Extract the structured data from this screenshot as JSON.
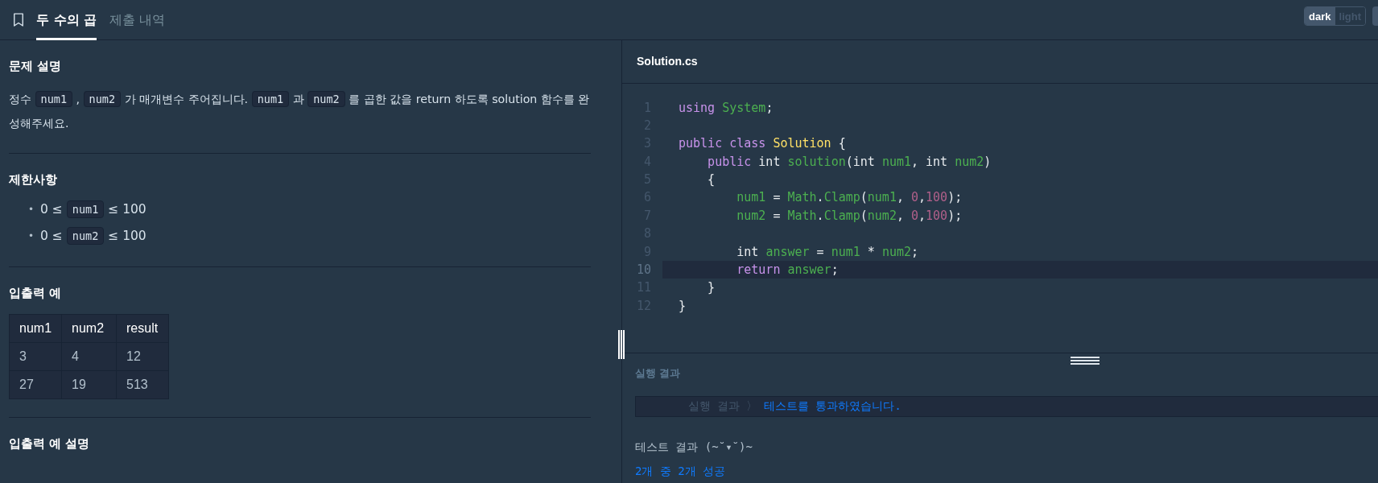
{
  "tabs": [
    {
      "label": "두 수의 곱",
      "selected": true
    },
    {
      "label": "제출 내역",
      "selected": false
    }
  ],
  "theme_toggle": [
    {
      "label": "dark",
      "selected": true
    },
    {
      "label": "light",
      "selected": false
    }
  ],
  "description": {
    "title": "문제 설명",
    "paragraph": [
      {
        "kind": "text",
        "text": "정수 "
      },
      {
        "kind": "code",
        "text": "num1"
      },
      {
        "kind": "text",
        "text": " , "
      },
      {
        "kind": "code",
        "text": "num2"
      },
      {
        "kind": "text",
        "text": " 가 매개변수 주어집니다. "
      },
      {
        "kind": "code",
        "text": "num1"
      },
      {
        "kind": "text",
        "text": " 과 "
      },
      {
        "kind": "code",
        "text": "num2"
      },
      {
        "kind": "text",
        "text": " 를 곱한 값을 return 하도록 solution 함수를 완성해주세요."
      }
    ]
  },
  "constraints": {
    "title": "제한사항",
    "items": [
      {
        "marker": "•",
        "segments": [
          {
            "kind": "text",
            "text": "0 ≤ "
          },
          {
            "kind": "code",
            "text": "num1"
          },
          {
            "kind": "text",
            "text": " ≤ 100"
          }
        ]
      },
      {
        "marker": "•",
        "segments": [
          {
            "kind": "text",
            "text": "0 ≤ "
          },
          {
            "kind": "code",
            "text": "num2"
          },
          {
            "kind": "text",
            "text": " ≤ 100"
          }
        ]
      }
    ]
  },
  "examples": {
    "title": "입출력 예",
    "columns": [
      "num1",
      "num2",
      "result"
    ],
    "rows": [
      [
        "3",
        "4",
        "12"
      ],
      [
        "27",
        "19",
        "513"
      ]
    ]
  },
  "examples_explanation": {
    "title": "입출력 예 설명"
  },
  "editor": {
    "filename": "Solution.cs",
    "lines": [
      {
        "number": "1",
        "highlighted": false,
        "tokens": [
          {
            "kind": "keyword",
            "text": "using "
          },
          {
            "kind": "ident",
            "text": "System"
          },
          {
            "kind": "plain",
            "text": ";"
          }
        ]
      },
      {
        "number": "2",
        "highlighted": false
      },
      {
        "number": "3",
        "highlighted": false,
        "tokens": [
          {
            "kind": "keyword",
            "text": "public class "
          },
          {
            "kind": "type",
            "text": "Solution"
          },
          {
            "kind": "plain",
            "text": " {"
          }
        ]
      },
      {
        "number": "4",
        "highlighted": false,
        "tokens": [
          {
            "kind": "keyword",
            "text": "    public"
          },
          {
            "kind": "plain",
            "text": " int "
          },
          {
            "kind": "ident",
            "text": "solution"
          },
          {
            "kind": "plain",
            "text": "(int "
          },
          {
            "kind": "ident",
            "text": "num1"
          },
          {
            "kind": "plain",
            "text": ", int "
          },
          {
            "kind": "ident",
            "text": "num2"
          },
          {
            "kind": "plain",
            "text": ")"
          }
        ]
      },
      {
        "number": "5",
        "highlighted": false,
        "tokens": [
          {
            "kind": "plain",
            "text": "    {"
          }
        ]
      },
      {
        "number": "6",
        "highlighted": false,
        "tokens": [
          {
            "kind": "ident",
            "text": "        num1"
          },
          {
            "kind": "plain",
            "text": " = "
          },
          {
            "kind": "ident",
            "text": "Math"
          },
          {
            "kind": "plain",
            "text": "."
          },
          {
            "kind": "ident",
            "text": "Clamp"
          },
          {
            "kind": "plain",
            "text": "("
          },
          {
            "kind": "ident",
            "text": "num1"
          },
          {
            "kind": "plain",
            "text": ", "
          },
          {
            "kind": "number",
            "text": "0"
          },
          {
            "kind": "plain",
            "text": ","
          },
          {
            "kind": "number",
            "text": "100"
          },
          {
            "kind": "plain",
            "text": ");"
          }
        ]
      },
      {
        "number": "7",
        "highlighted": false,
        "tokens": [
          {
            "kind": "ident",
            "text": "        num2"
          },
          {
            "kind": "plain",
            "text": " = "
          },
          {
            "kind": "ident",
            "text": "Math"
          },
          {
            "kind": "plain",
            "text": "."
          },
          {
            "kind": "ident",
            "text": "Clamp"
          },
          {
            "kind": "plain",
            "text": "("
          },
          {
            "kind": "ident",
            "text": "num2"
          },
          {
            "kind": "plain",
            "text": ", "
          },
          {
            "kind": "number",
            "text": "0"
          },
          {
            "kind": "plain",
            "text": ","
          },
          {
            "kind": "number",
            "text": "100"
          },
          {
            "kind": "plain",
            "text": ");"
          }
        ]
      },
      {
        "number": "8",
        "highlighted": false
      },
      {
        "number": "9",
        "highlighted": false,
        "tokens": [
          {
            "kind": "plain",
            "text": "        int "
          },
          {
            "kind": "ident",
            "text": "answer"
          },
          {
            "kind": "plain",
            "text": " = "
          },
          {
            "kind": "ident",
            "text": "num1"
          },
          {
            "kind": "plain",
            "text": " * "
          },
          {
            "kind": "ident",
            "text": "num2"
          },
          {
            "kind": "plain",
            "text": ";"
          }
        ]
      },
      {
        "number": "10",
        "highlighted": true,
        "tokens": [
          {
            "kind": "keyword",
            "text": "        return "
          },
          {
            "kind": "ident",
            "text": "answer"
          },
          {
            "kind": "plain",
            "text": ";"
          }
        ]
      },
      {
        "number": "11",
        "highlighted": false,
        "tokens": [
          {
            "kind": "plain",
            "text": "    }"
          }
        ]
      },
      {
        "number": "12",
        "highlighted": false,
        "tokens": [
          {
            "kind": "plain",
            "text": "}"
          }
        ]
      }
    ]
  },
  "results": {
    "title": "실행 결과",
    "output_label": "실행 결과 〉",
    "output_message": "테스트를 통과하였습니다.",
    "summary_title": "테스트 결과 (~˘▾˘)~",
    "summary": "2개 중 2개 성공"
  }
}
